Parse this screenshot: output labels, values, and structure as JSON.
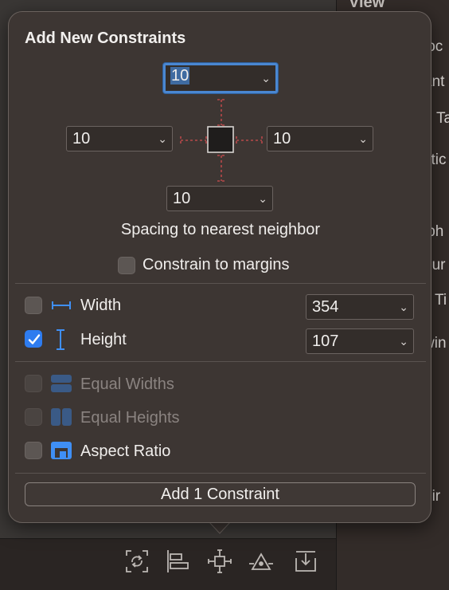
{
  "inspector": {
    "header": "View",
    "items": [
      "loc",
      "ant",
      "Ta",
      "ctic",
      "lph",
      "our",
      "Ti",
      "win",
      "hir"
    ]
  },
  "popover": {
    "title": "Add New Constraints",
    "spacing": {
      "top": "10",
      "left": "10",
      "right": "10",
      "bottom": "10"
    },
    "spacing_label": "Spacing to nearest neighbor",
    "constrain_margins": {
      "label": "Constrain to margins",
      "checked": false
    },
    "width": {
      "label": "Width",
      "value": "354",
      "checked": false
    },
    "height": {
      "label": "Height",
      "value": "107",
      "checked": true
    },
    "equal_widths": {
      "label": "Equal Widths",
      "enabled": false
    },
    "equal_heights": {
      "label": "Equal Heights",
      "enabled": false
    },
    "aspect_ratio": {
      "label": "Aspect Ratio",
      "checked": false
    },
    "add_button": "Add 1 Constraint"
  },
  "toolbar": {
    "icons": [
      "update-frames-icon",
      "align-icon",
      "add-constraints-icon",
      "resolve-issues-icon",
      "embed-in-icon"
    ]
  },
  "colors": {
    "accent": "#2e7cf0",
    "constraint_line": "#b8484a",
    "popover_bg": "#3d3633"
  }
}
